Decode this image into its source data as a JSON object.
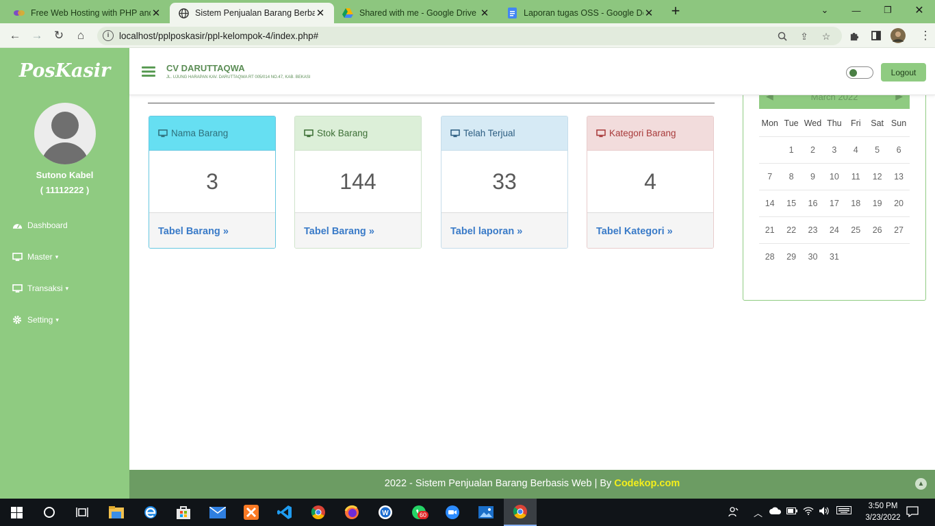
{
  "browser": {
    "tabs": [
      {
        "title": "Free Web Hosting with PHP and M",
        "active": false
      },
      {
        "title": "Sistem Penjualan Barang Berbasis W",
        "active": true
      },
      {
        "title": "Shared with me - Google Drive",
        "active": false
      },
      {
        "title": "Laporan tugas OSS - Google Docs",
        "active": false
      }
    ],
    "url": "localhost/pplposkasir/ppl-kelompok-4/index.php#"
  },
  "sidebar": {
    "logo": "PosKasir",
    "user_name": "Sutono Kabel",
    "user_id": "( 11112222 )",
    "nav": [
      {
        "label": "Dashboard",
        "icon": "dashboard-icon",
        "has_submenu": false
      },
      {
        "label": "Master",
        "icon": "desktop-icon",
        "has_submenu": true
      },
      {
        "label": "Transaksi",
        "icon": "desktop-icon",
        "has_submenu": true
      },
      {
        "label": "Setting",
        "icon": "gear-icon",
        "has_submenu": true
      }
    ]
  },
  "header": {
    "company": "CV DARUTTAQWA",
    "address": "JL. UJUNG HARAPAN KAV. DARUTTAQWA RT 005/014 NO.47, KAB. BEKASI",
    "logout_label": "Logout"
  },
  "cards": [
    {
      "title": "Nama Barang",
      "value": "3",
      "link": "Tabel Barang",
      "head_bg": "#66dff2",
      "head_color": "#2f6f7a",
      "border": "#66c7e0"
    },
    {
      "title": "Stok Barang",
      "value": "144",
      "link": "Tabel Barang",
      "head_bg": "#dcefd8",
      "head_color": "#3c6e35",
      "border": "#cfe3cb"
    },
    {
      "title": "Telah Terjual",
      "value": "33",
      "link": "Tabel laporan",
      "head_bg": "#d6eaf5",
      "head_color": "#2b5c80",
      "border": "#c5dcea"
    },
    {
      "title": "Kategori Barang",
      "value": "4",
      "link": "Tabel Kategori",
      "head_bg": "#f2dcdc",
      "head_color": "#a83a3a",
      "border": "#e8cccc"
    }
  ],
  "calendar": {
    "month": "March 2022",
    "days_of_week": [
      "Mon",
      "Tue",
      "Wed",
      "Thu",
      "Fri",
      "Sat",
      "Sun"
    ],
    "weeks": [
      [
        "",
        "1",
        "2",
        "3",
        "4",
        "5",
        "6"
      ],
      [
        "7",
        "8",
        "9",
        "10",
        "11",
        "12",
        "13"
      ],
      [
        "14",
        "15",
        "16",
        "17",
        "18",
        "19",
        "20"
      ],
      [
        "21",
        "22",
        "23",
        "24",
        "25",
        "26",
        "27"
      ],
      [
        "28",
        "29",
        "30",
        "31",
        "",
        "",
        ""
      ]
    ]
  },
  "footer": {
    "text": "2022 - Sistem Penjualan Barang Berbasis Web | By ",
    "link": "Codekop.com"
  },
  "taskbar": {
    "time": "3:50 PM",
    "date": "3/23/2022",
    "whatsapp_badge": "60"
  }
}
